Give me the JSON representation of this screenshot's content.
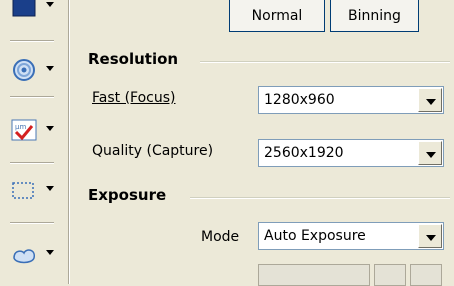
{
  "top_buttons": {
    "normal": "Normal",
    "binning": "Binning"
  },
  "resolution": {
    "title": "Resolution",
    "fast_label": "Fast (Focus)",
    "fast_value": "1280x960",
    "quality_label": "Quality (Capture)",
    "quality_value": "2560x1920"
  },
  "exposure": {
    "title": "Exposure",
    "mode_label": "Mode",
    "mode_value": "Auto Exposure"
  },
  "icons": [
    "monitor-icon",
    "target-icon",
    "measure-check-icon",
    "selection-rect-icon",
    "cloud-shape-icon"
  ]
}
